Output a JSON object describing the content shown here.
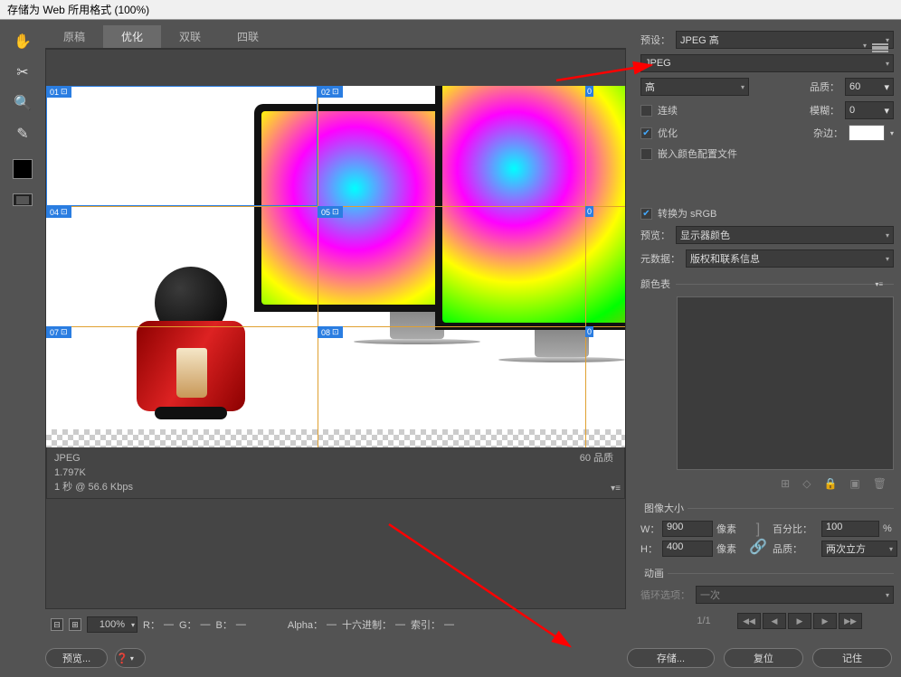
{
  "window": {
    "title": "存储为 Web 所用格式 (100%)"
  },
  "tabs": {
    "t1": "原稿",
    "t2": "优化",
    "t3": "双联",
    "t4": "四联"
  },
  "slices": {
    "s01": "01",
    "s02": "02",
    "s04": "04",
    "s05": "05",
    "s07": "07",
    "s08": "08",
    "boxed": "⊡"
  },
  "info": {
    "format": "JPEG",
    "size": "1.797K",
    "speed": "1 秒 @ 56.6 Kbps",
    "quality": "60 品质"
  },
  "zoombar": {
    "zoom": "100%",
    "r": "R：",
    "g": "G：",
    "b": "B：",
    "alpha": "Alpha：",
    "hex": "十六进制：",
    "index": "索引：",
    "dash": "—"
  },
  "right": {
    "preset_label": "预设：",
    "preset_value": "JPEG 高",
    "format_value": "JPEG",
    "quality_sel": "高",
    "quality_label": "品质：",
    "quality_val": "60",
    "progressive": "连续",
    "blur_label": "模糊：",
    "blur_val": "0",
    "optimized": "优化",
    "matte_label": "杂边：",
    "embed_profile": "嵌入颜色配置文件",
    "convert_srgb": "转换为 sRGB",
    "preview_label": "预览：",
    "preview_value": "显示器颜色",
    "metadata_label": "元数据：",
    "metadata_value": "版权和联系信息",
    "colortable": "颜色表",
    "imagesize_title": "图像大小",
    "w_label": "W：",
    "w_val": "900",
    "px": "像素",
    "percent_label": "百分比：",
    "percent_val": "100",
    "pct": "%",
    "h_label": "H：",
    "h_val": "400",
    "quality2_label": "品质：",
    "quality2_val": "两次立方",
    "anim_title": "动画",
    "loop_label": "循环选项：",
    "loop_val": "一次",
    "frame": "1/1"
  },
  "buttons": {
    "preview": "预览...",
    "save": "存储...",
    "reset": "复位",
    "remember": "记住",
    "help": "❓"
  }
}
